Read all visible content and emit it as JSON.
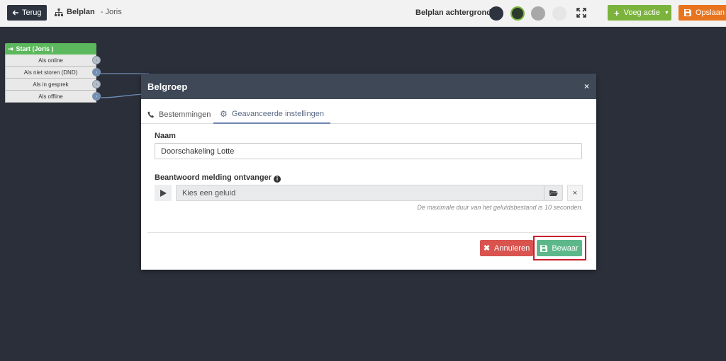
{
  "topbar": {
    "back_label": "Terug",
    "plan_title": "Belplan",
    "plan_separator": " - ",
    "plan_owner": "Joris",
    "background_label": "Belplan achtergrond",
    "swatches": [
      "#2d3440",
      "#2b3a2c",
      "#a8a8a8",
      "#e6e6e6"
    ],
    "add_action_label": "Voeg actie",
    "save_label": "Opslaan",
    "icons": {
      "back": "arrow-left-icon",
      "plan": "sitemap-icon",
      "fullscreen": "expand-icon",
      "add": "plus-icon",
      "save": "floppy-disk-icon",
      "dropdown": "caret-down-icon"
    }
  },
  "canvas": {
    "node": {
      "title": "Start (Joris )",
      "rows": [
        "Als online",
        "Als niet storen (DND)",
        "Als in gesprek",
        "Als offline"
      ],
      "active_ports": [
        1,
        3
      ]
    },
    "connector_color": "#6e8fb8"
  },
  "modal": {
    "title": "Belgroep",
    "close_label": "×",
    "tabs": [
      {
        "label": "Bestemmingen",
        "icon": "phone-icon",
        "active": false
      },
      {
        "label": "Geavanceerde instellingen",
        "icon": "gear-icon",
        "active": true
      }
    ],
    "name_label": "Naam",
    "name_value": "Doorschakeling Lotte",
    "announce_label": "Beantwoord melding ontvanger",
    "sound_placeholder": "Kies een geluid",
    "hint": "De maximale duur van het geluidsbestand is 10 seconden.",
    "clear_label": "×",
    "cancel_label": "Annuleren",
    "confirm_label": "Bewaar"
  },
  "colors": {
    "canvas_bg": "#2b2f39",
    "modal_header": "#3e4857",
    "green": "#7bb33d",
    "orange": "#e8741d",
    "danger": "#d9534f",
    "success": "#5cb88a",
    "highlight": "#c8202e"
  }
}
